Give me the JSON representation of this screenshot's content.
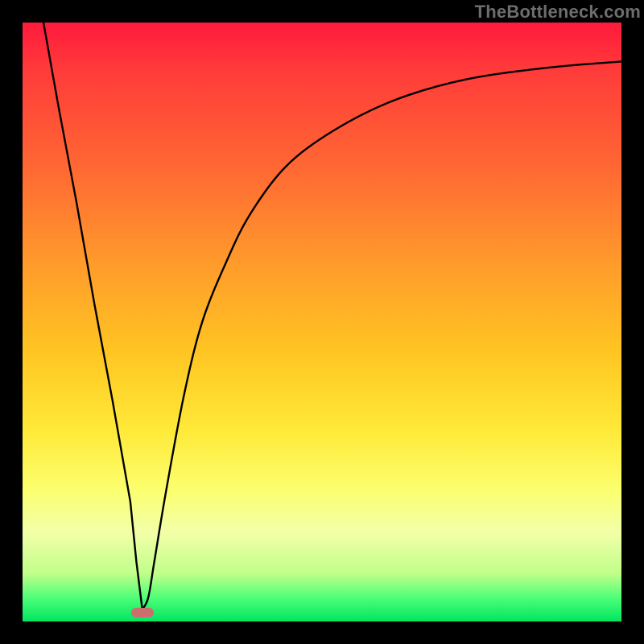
{
  "watermark": "TheBottleneck.com",
  "chart_data": {
    "type": "line",
    "title": "",
    "xlabel": "",
    "ylabel": "",
    "xlim": [
      0,
      100
    ],
    "ylim": [
      0,
      100
    ],
    "series": [
      {
        "name": "bottleneck-curve",
        "x": [
          3.5,
          6,
          9,
          12,
          15,
          18,
          19,
          20,
          21,
          22,
          24,
          27,
          30,
          34,
          38,
          44,
          52,
          62,
          74,
          88,
          100
        ],
        "y": [
          100,
          86,
          70,
          53,
          37,
          20,
          10,
          2,
          4,
          10,
          22,
          38,
          50,
          60,
          68,
          76,
          82,
          87,
          90.5,
          92.5,
          93.5
        ]
      }
    ],
    "marker": {
      "x": 20,
      "y": 1.5,
      "color": "#cb6f6e"
    },
    "background_gradient": {
      "top": "#ff1a3c",
      "mid": "#ffe938",
      "bottom": "#00e560"
    }
  }
}
